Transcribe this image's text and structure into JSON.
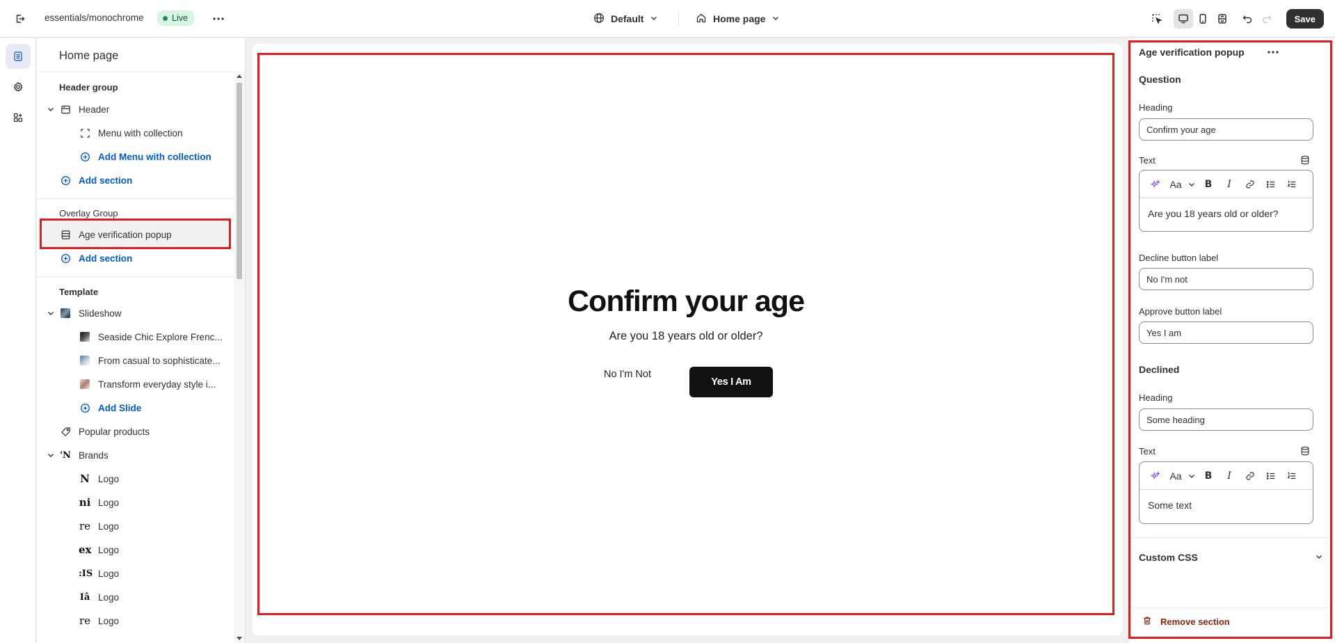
{
  "topbar": {
    "store_path": "essentials/monochrome",
    "status_badge": "Live",
    "theme_selector": "Default",
    "page_selector": "Home page",
    "save_label": "Save"
  },
  "sidebar": {
    "title": "Home page",
    "header_group": {
      "label": "Header group",
      "header": "Header",
      "menu_item": "Menu with collection",
      "add_menu": "Add Menu with collection",
      "add_section": "Add section"
    },
    "overlay_group": {
      "label": "Overlay Group",
      "age_popup": "Age verification popup",
      "add_section": "Add section"
    },
    "template": {
      "label": "Template",
      "slideshow": "Slideshow",
      "slides": [
        "Seaside Chic Explore Frenc...",
        "From casual to sophisticate...",
        "Transform everyday style i..."
      ],
      "add_slide": "Add Slide",
      "popular_products": "Popular products",
      "brands": "Brands",
      "logos": [
        {
          "glyph": "N",
          "label": "Logo"
        },
        {
          "glyph": "ni",
          "label": "Logo"
        },
        {
          "glyph": "re",
          "label": "Logo"
        },
        {
          "glyph": "ex",
          "label": "Logo"
        },
        {
          "glyph": ":IS",
          "label": "Logo"
        },
        {
          "glyph": "Iâ",
          "label": "Logo"
        },
        {
          "glyph": "re",
          "label": "Logo"
        }
      ]
    }
  },
  "preview": {
    "heading": "Confirm your age",
    "text": "Are you 18 years old or older?",
    "decline": "No I'm Not",
    "approve": "Yes I Am"
  },
  "settings": {
    "title": "Age verification popup",
    "question_section": "Question",
    "heading_label": "Heading",
    "heading_value": "Confirm your age",
    "text_label": "Text",
    "text_value": "Are you 18 years old or older?",
    "decline_label": "Decline button label",
    "decline_value": "No I'm not",
    "approve_label": "Approve button label",
    "approve_value": "Yes I am",
    "declined_section": "Declined",
    "declined_heading_label": "Heading",
    "declined_heading_value": "Some heading",
    "declined_text_label": "Text",
    "declined_text_value": "Some text",
    "custom_css": "Custom CSS",
    "remove_section": "Remove section",
    "font_size_glyph": "Aa"
  },
  "colors": {
    "accent_blue": "#005bd3",
    "highlight_red": "#e01e1e",
    "live_badge_bg": "#d6f5e3",
    "remove_red": "#8e1f0b",
    "primary_dark": "#303030"
  }
}
